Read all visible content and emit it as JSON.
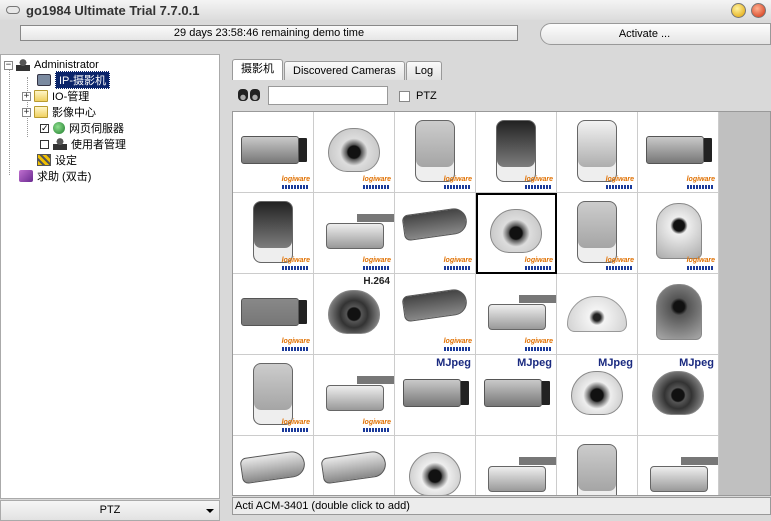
{
  "window": {
    "title": "go1984 Ultimate Trial 7.7.0.1"
  },
  "demo_status": "29 days 23:58:46 remaining demo time",
  "activate_label": "Activate ...",
  "tree": {
    "root": "Administrator",
    "items": [
      {
        "label": "IP-摄影机",
        "selected": true
      },
      {
        "label": "IO-管理"
      },
      {
        "label": "影像中心"
      },
      {
        "label": "网页伺服器",
        "checked": true
      },
      {
        "label": "使用者管理",
        "checked": false
      },
      {
        "label": "设定"
      }
    ],
    "help": "求助 (双击)"
  },
  "ptz_dropdown": "PTZ",
  "tabs": [
    "摄影机",
    "Discovered Cameras",
    "Log"
  ],
  "search": {
    "value": "",
    "placeholder": ""
  },
  "ptz_filter_label": "PTZ",
  "cameras": [
    {
      "badge": "logi"
    },
    {
      "badge": "logi"
    },
    {
      "badge": "logi"
    },
    {
      "badge": "logi"
    },
    {
      "badge": "logi"
    },
    {
      "badge": "logi"
    },
    {
      "badge": "logi"
    },
    {
      "badge": "logi"
    },
    {
      "badge": "logi"
    },
    {
      "badge": "logi",
      "highlighted": true
    },
    {
      "badge": "logi"
    },
    {
      "badge": "logi"
    },
    {
      "badge": "logi"
    },
    {
      "badge": "H.264"
    },
    {
      "badge": "logi"
    },
    {
      "badge": "logi"
    },
    {
      "badge": ""
    },
    {
      "badge": ""
    },
    {
      "badge": "logi"
    },
    {
      "badge": "logi"
    },
    {
      "badge": "MJpeg"
    },
    {
      "badge": "MJpeg"
    },
    {
      "badge": "MJpeg"
    },
    {
      "badge": "MJpeg"
    },
    {
      "badge": ""
    },
    {
      "badge": ""
    },
    {
      "badge": ""
    },
    {
      "badge": ""
    },
    {
      "badge": ""
    },
    {
      "badge": ""
    }
  ],
  "logi_text": "logiware",
  "status_text": "Acti ACM-3401 (double click to add)"
}
